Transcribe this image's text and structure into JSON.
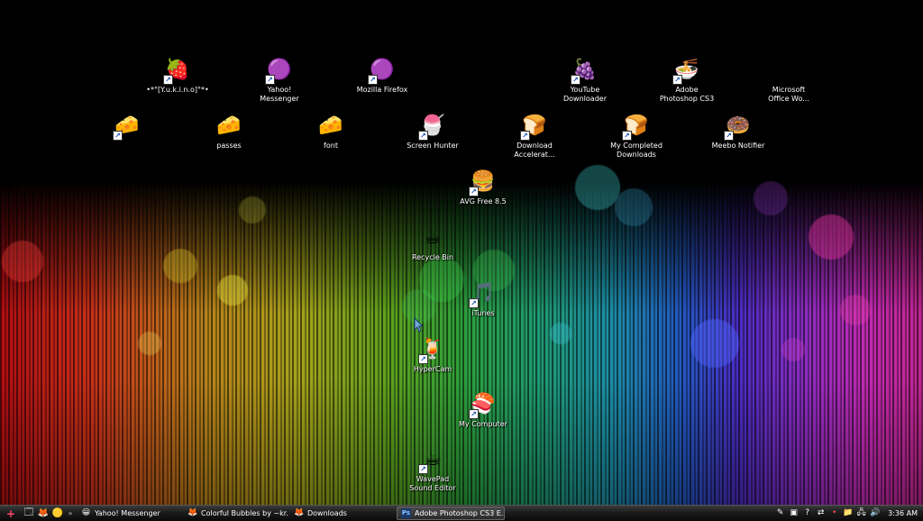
{
  "desktop": {
    "icons": [
      {
        "label": "•*°[Y.u.k.i.n.o]°*•",
        "glyph": "🍓",
        "icon": "strawberry-icon"
      },
      {
        "label": "Yahoo!\nMessenger",
        "glyph": "🟣",
        "icon": "pink-bubble-icon"
      },
      {
        "label": "Mozilla Firefox",
        "glyph": "🟣",
        "icon": "pink-bubble-icon"
      },
      {
        "label": "YouTube\nDownloader",
        "glyph": "🍇",
        "icon": "grapes-icon"
      },
      {
        "label": "Adobe\nPhotoshop CS3",
        "glyph": "🍜",
        "icon": "noodle-bowl-icon"
      },
      {
        "label": "Microsoft\nOffice Wo...",
        "glyph": "☕",
        "icon": "teacup-icon"
      },
      {
        "label": "",
        "glyph": "🧀",
        "icon": "cheese-icon"
      },
      {
        "label": "passes",
        "glyph": "🧀",
        "icon": "cheese-icon"
      },
      {
        "label": "font",
        "glyph": "🧀",
        "icon": "cheese-icon"
      },
      {
        "label": "Screen Hunter",
        "glyph": "🍧",
        "icon": "shaved-ice-icon"
      },
      {
        "label": "Download\nAccelerat...",
        "glyph": "🍞",
        "icon": "toast-icon"
      },
      {
        "label": "My Completed\nDownloads",
        "glyph": "🍞",
        "icon": "toast-icon"
      },
      {
        "label": "Meebo Notifier",
        "glyph": "🍩",
        "icon": "donut-icon"
      },
      {
        "label": "AVG Free 8.5",
        "glyph": "🍔",
        "icon": "burger-icon"
      },
      {
        "label": "Recycle Bin",
        "glyph": "☕",
        "icon": "coffee-cup-icon"
      },
      {
        "label": "iTunes",
        "glyph": "🎵",
        "icon": "itunes-icon"
      },
      {
        "label": "HyperCam",
        "glyph": "🍹",
        "icon": "drink-icon"
      },
      {
        "label": "My Computer",
        "glyph": "🍣",
        "icon": "sushi-plate-icon"
      },
      {
        "label": "WavePad\nSound Editor",
        "glyph": "☕",
        "icon": "coffee-mug-icon"
      }
    ]
  },
  "taskbar": {
    "start_glyph": "+",
    "quick_launch": [
      {
        "glyph": "🗔",
        "icon": "show-desktop-icon"
      },
      {
        "glyph": "🦊",
        "icon": "firefox-icon"
      },
      {
        "glyph": "🟡",
        "icon": "yahoo-icon"
      }
    ],
    "more": "»",
    "tasks": [
      {
        "label": "Yahoo! Messenger",
        "glyph": "😀",
        "icon": "yahoo-messenger-icon",
        "active": false
      },
      {
        "label": "Colorful Bubbles by ~kr...",
        "glyph": "🦊",
        "icon": "firefox-icon",
        "active": false
      },
      {
        "label": "Downloads",
        "glyph": "🦊",
        "icon": "firefox-icon",
        "active": false
      },
      {
        "label": "Adobe Photoshop CS3 E...",
        "glyph": "Ps",
        "icon": "photoshop-icon",
        "active": true
      }
    ],
    "tray_icons": [
      {
        "glyph": "✎",
        "icon": "pen-icon"
      },
      {
        "glyph": "▣",
        "icon": "window-icon"
      },
      {
        "glyph": "?",
        "icon": "help-icon"
      },
      {
        "glyph": "⇄",
        "icon": "sync-icon"
      },
      {
        "glyph": "•",
        "icon": "dot-icon"
      },
      {
        "glyph": "📁",
        "icon": "folder-icon"
      },
      {
        "glyph": "🖧",
        "icon": "network-icon"
      },
      {
        "glyph": "🔊",
        "icon": "volume-icon"
      }
    ],
    "clock": "3:36 AM"
  }
}
